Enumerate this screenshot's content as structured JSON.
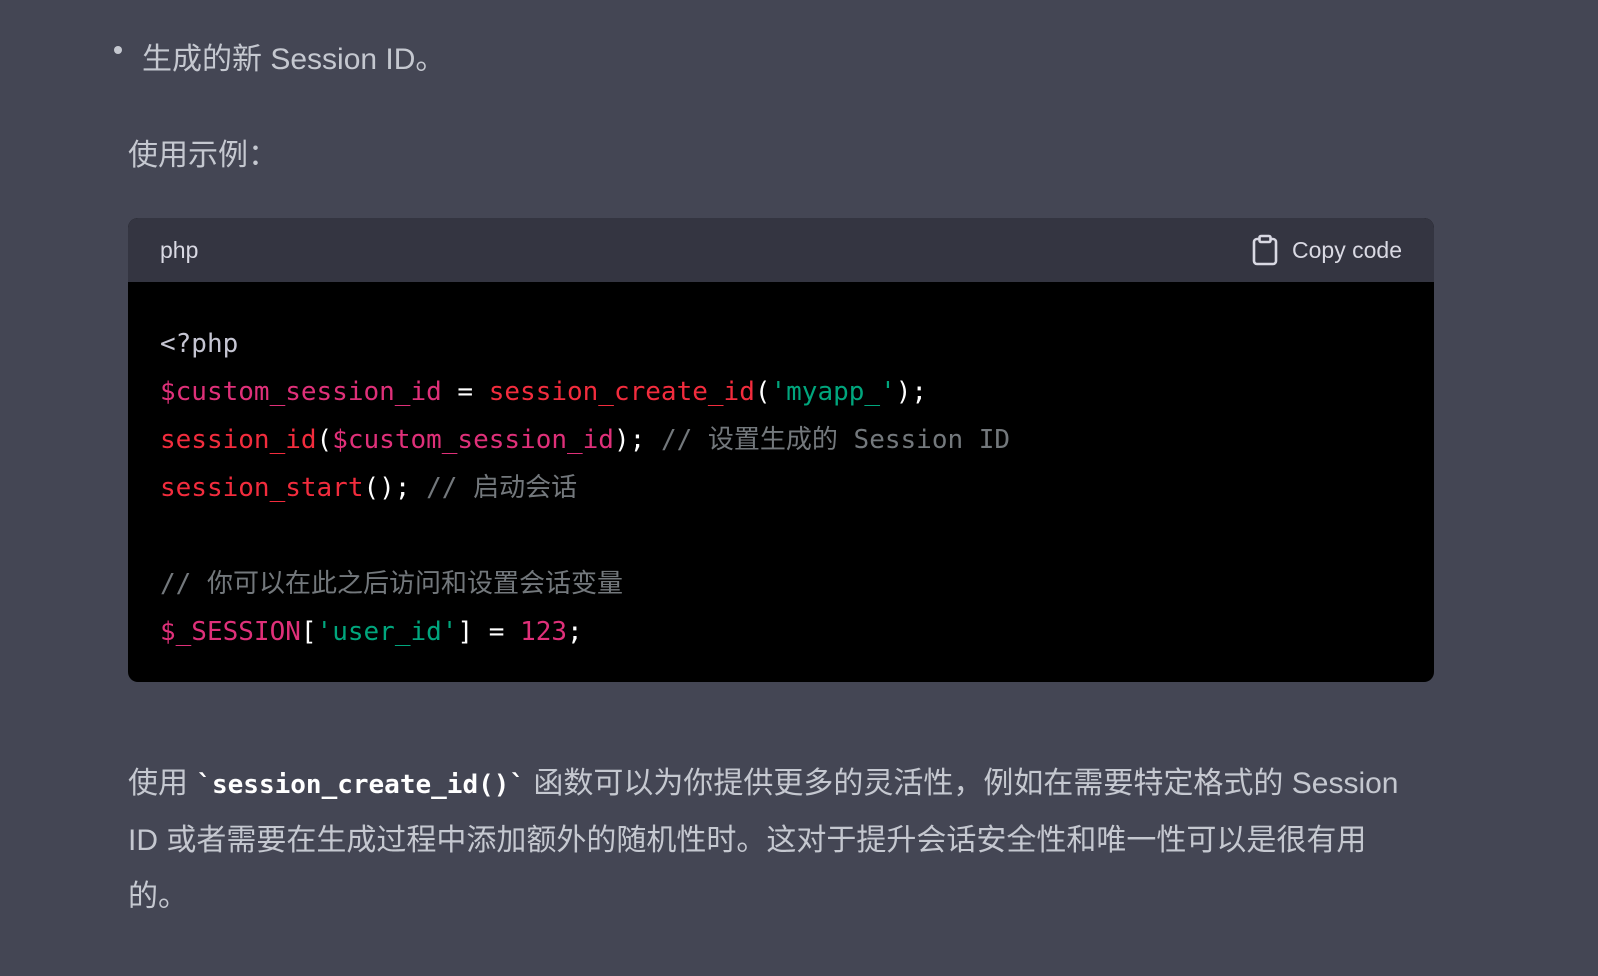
{
  "bullet": {
    "text": "生成的新 Session ID。"
  },
  "example_label": "使用示例：",
  "code_block": {
    "language": "php",
    "copy_label": "Copy code",
    "lines": [
      [
        {
          "t": "<?php",
          "c": "meta"
        }
      ],
      [
        {
          "t": "$custom_session_id",
          "c": "var"
        },
        {
          "t": " = ",
          "c": "punc"
        },
        {
          "t": "session_create_id",
          "c": "fn"
        },
        {
          "t": "(",
          "c": "punc"
        },
        {
          "t": "'myapp_'",
          "c": "str"
        },
        {
          "t": ");",
          "c": "punc"
        }
      ],
      [
        {
          "t": "session_id",
          "c": "fn"
        },
        {
          "t": "(",
          "c": "punc"
        },
        {
          "t": "$custom_session_id",
          "c": "var"
        },
        {
          "t": "); ",
          "c": "punc"
        },
        {
          "t": "// 设置生成的 Session ID",
          "c": "comment"
        }
      ],
      [
        {
          "t": "session_start",
          "c": "fn"
        },
        {
          "t": "(); ",
          "c": "punc"
        },
        {
          "t": "// 启动会话",
          "c": "comment"
        }
      ],
      [],
      [
        {
          "t": "// 你可以在此之后访问和设置会话变量",
          "c": "comment"
        }
      ],
      [
        {
          "t": "$_SESSION",
          "c": "var"
        },
        {
          "t": "[",
          "c": "punc"
        },
        {
          "t": "'user_id'",
          "c": "str"
        },
        {
          "t": "] = ",
          "c": "punc"
        },
        {
          "t": "123",
          "c": "num"
        },
        {
          "t": ";",
          "c": "punc"
        }
      ]
    ]
  },
  "paragraph": {
    "before": "使用 ",
    "inline_code": "`session_create_id()`",
    "after": " 函数可以为你提供更多的灵活性，例如在需要特定格式的 Session ID 或者需要在生成过程中添加额外的随机性时。这对于提升会话安全性和唯一性可以是很有用的。"
  },
  "colors": {
    "background": "#444654",
    "code_header": "#343541",
    "code_body": "#000000",
    "variable": "#df3079",
    "function": "#f22c3d",
    "string": "#00a67d"
  },
  "icons": {
    "copy": "clipboard-icon"
  }
}
